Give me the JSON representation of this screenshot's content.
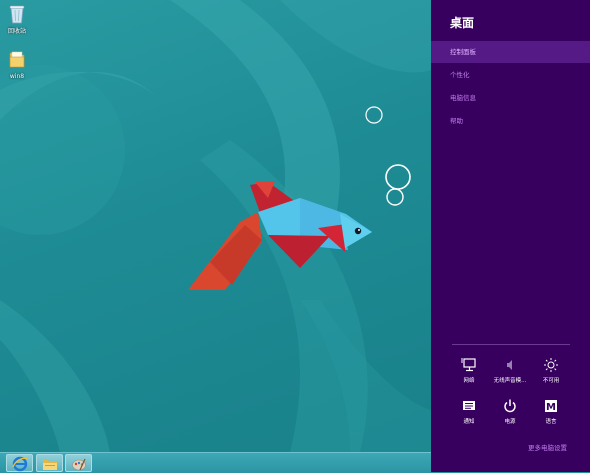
{
  "desktop": {
    "icons": [
      {
        "label": "回收站",
        "icon": "recycle-bin-icon"
      },
      {
        "label": "win8",
        "icon": "folder-icon"
      }
    ]
  },
  "taskbar": {
    "buttons": [
      {
        "icon": "internet-explorer-icon"
      },
      {
        "icon": "file-explorer-icon"
      },
      {
        "icon": "paint-icon"
      }
    ]
  },
  "charm": {
    "title": "桌面",
    "links": [
      {
        "label": "控制面板",
        "selected": true
      },
      {
        "label": "个性化",
        "selected": false
      },
      {
        "label": "电脑信息",
        "selected": false
      },
      {
        "label": "帮助",
        "selected": false
      }
    ],
    "tiles": [
      {
        "label": "网络",
        "icon": "network-icon"
      },
      {
        "label": "无线声音模...",
        "icon": "speaker-icon"
      },
      {
        "label": "不可用",
        "icon": "brightness-icon"
      },
      {
        "label": "通知",
        "icon": "notifications-icon"
      },
      {
        "label": "电源",
        "icon": "power-icon"
      },
      {
        "label": "语言",
        "icon": "language-icon"
      }
    ],
    "language_glyph": "M",
    "more_label": "更多电脑设置"
  },
  "colors": {
    "charm_bg": "#37005f",
    "charm_accent": "#c57ef0",
    "desktop_bg": "#1f8f98"
  }
}
